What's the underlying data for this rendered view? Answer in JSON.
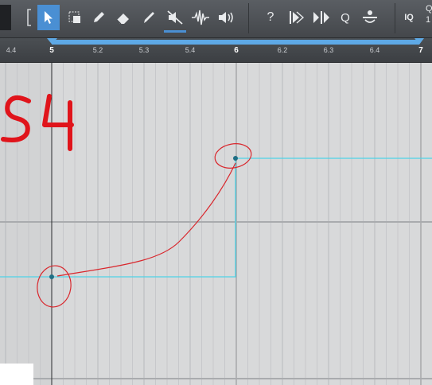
{
  "toolbar": {
    "tools": [
      {
        "name": "arrow",
        "label": "Arrow Tool"
      },
      {
        "name": "range",
        "label": "Range Tool"
      },
      {
        "name": "pencil",
        "label": "Pencil"
      },
      {
        "name": "eraser",
        "label": "Eraser"
      },
      {
        "name": "paint",
        "label": "Paint Tool"
      },
      {
        "name": "mute",
        "label": "Mute Tool"
      },
      {
        "name": "bend",
        "label": "Bend Tool"
      },
      {
        "name": "listen",
        "label": "Listen Tool"
      }
    ],
    "help_label": "?",
    "quantize_label": "Q",
    "iq_label": "IQ",
    "right_stub": "Q",
    "right_stub_sub": "1"
  },
  "ruler": {
    "ticks": [
      {
        "label": "4.4",
        "major": false
      },
      {
        "label": "5",
        "major": true
      },
      {
        "label": "5.2",
        "major": false
      },
      {
        "label": "5.3",
        "major": false
      },
      {
        "label": "5.4",
        "major": false
      },
      {
        "label": "6",
        "major": true
      },
      {
        "label": "6.2",
        "major": false
      },
      {
        "label": "6.3",
        "major": false
      },
      {
        "label": "6.4",
        "major": false
      },
      {
        "label": "7",
        "major": true
      }
    ]
  },
  "annotation": {
    "text": "S4",
    "color": "#e0141b"
  },
  "colors": {
    "automation_line": "#4fd3e6",
    "handle": "#1f6f85",
    "scribble": "#d9262c",
    "loop_bar": "#5ea9e6"
  }
}
